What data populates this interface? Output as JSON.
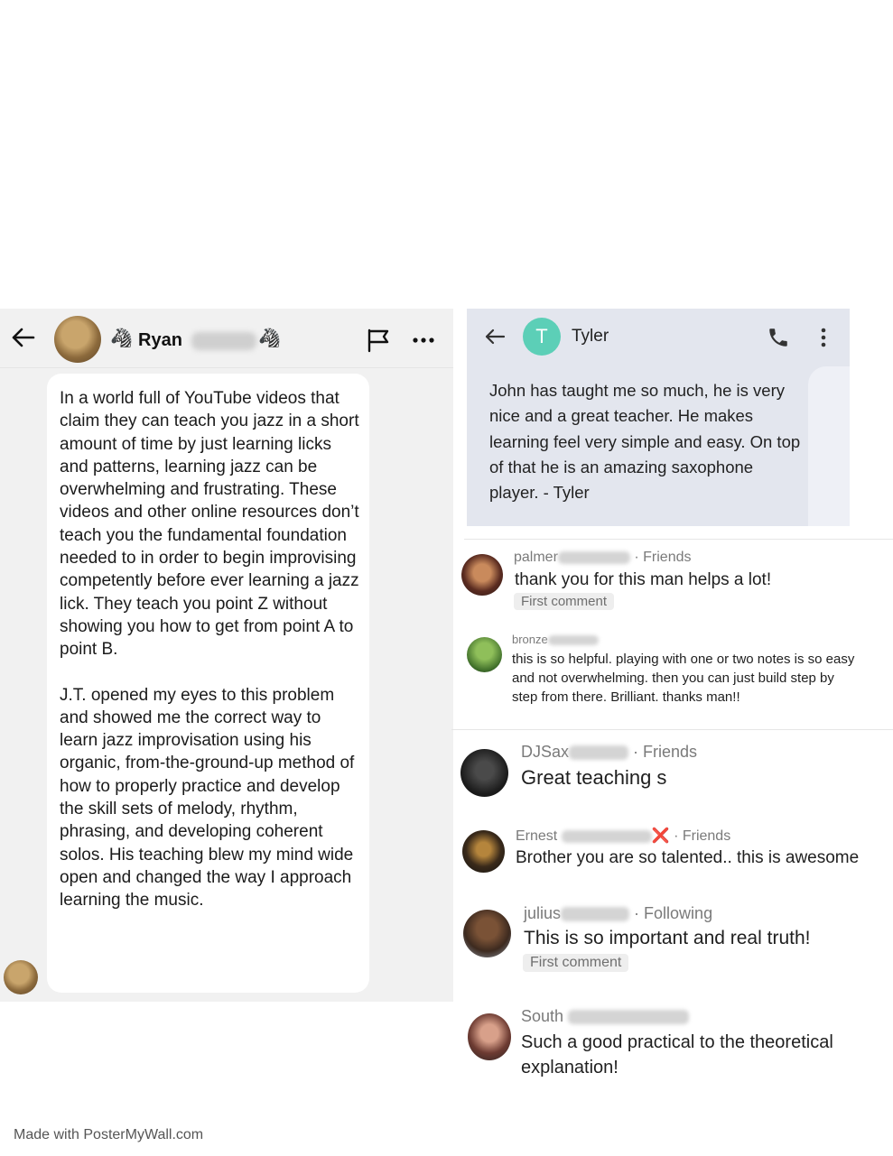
{
  "messenger": {
    "contact_name": "Ryan",
    "zebra_emoji": "🦓",
    "message_paragraphs": [
      "In a world full of YouTube videos that claim they can teach you jazz in a short amount of time by just learning licks and patterns, learning jazz can be overwhelming and frustrating. These videos and other online resources don’t teach you the fundamental foundation needed to in order to begin improvising competently before ever learning a jazz lick. They teach you point Z without showing you how to get from point A to point B.",
      "J.T. opened my eyes to this problem and showed me the correct way to learn jazz improvisation using his organic, from-the-ground-up method of how to properly practice and develop the skill sets of melody, rhythm, phrasing, and developing coherent solos. His teaching blew my mind wide open and changed the way I approach learning the music."
    ]
  },
  "sms": {
    "avatar_letter": "T",
    "contact_name": "Tyler",
    "message": "John has taught me so much, he is very nice and a great teacher. He makes learning feel very simple and easy. On top of that he is an amazing saxophone player. - Tyler"
  },
  "comments": [
    {
      "name": "palmer",
      "relation": "· Friends",
      "text": "thank you for this man helps a lot!",
      "badge": "First comment"
    },
    {
      "name": "bronze",
      "relation": "",
      "text": "this is so helpful. playing with one or two notes is so easy and not overwhelming. then you can just build step by step from there. Brilliant. thanks man!!",
      "badge": ""
    },
    {
      "name": "DJSax",
      "relation": "· Friends",
      "text": "Great teaching s",
      "badge": ""
    },
    {
      "name": "Ernest",
      "mark": "❌",
      "relation": "· Friends",
      "text": "Brother you are so talented.. this is awesome",
      "badge": ""
    },
    {
      "name": "julius",
      "relation": "· Following",
      "text": "This is so important and real truth!",
      "badge": "First comment"
    },
    {
      "name": "South",
      "relation": "",
      "text": "Such a good practical to the theoretical explanation!",
      "badge": ""
    }
  ],
  "footer": "Made with PosterMyWall.com",
  "colors": {
    "sms_avatar": "#5ccfb7",
    "sms_panel": "#e3e6ee",
    "chat_panel": "#f1f1f1"
  }
}
